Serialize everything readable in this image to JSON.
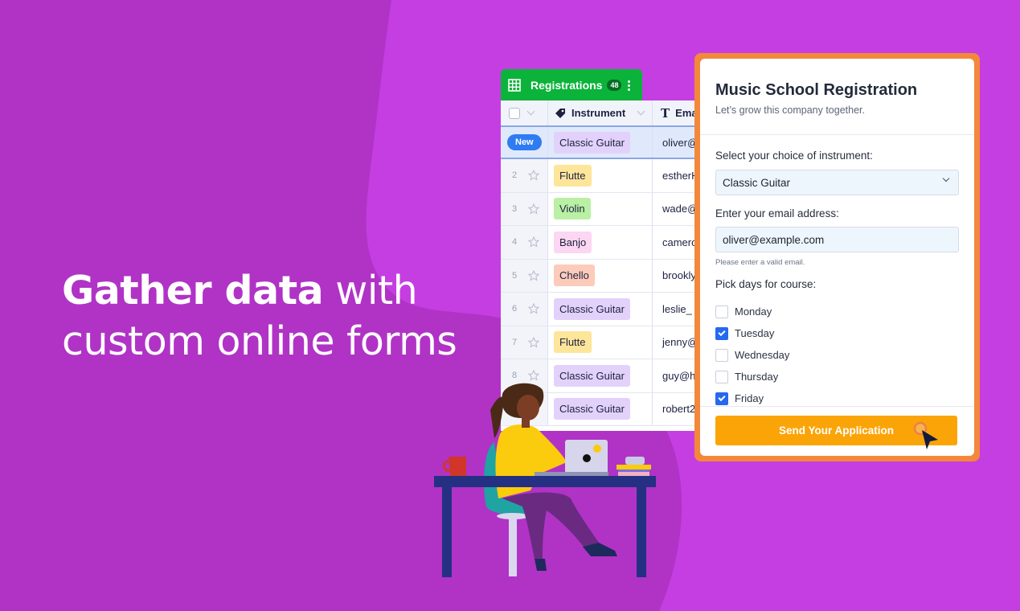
{
  "headline": {
    "bold": "Gather data",
    "rest_line1": " with",
    "line2": "custom online forms"
  },
  "table": {
    "title": "Registrations",
    "count": "48",
    "columns": [
      {
        "label": "Instrument",
        "icon": "tag-icon"
      },
      {
        "label": "Ema",
        "icon": "text-type-icon"
      }
    ],
    "new_label": "New",
    "rows": [
      {
        "num": "New",
        "instrument": "Classic Guitar",
        "email": "oliver@",
        "chip_color": "#e2d2fb"
      },
      {
        "num": "2",
        "instrument": "Flutte",
        "email": "estherH",
        "chip_color": "#fde59a"
      },
      {
        "num": "3",
        "instrument": "Violin",
        "email": "wade@",
        "chip_color": "#b9f0a4"
      },
      {
        "num": "4",
        "instrument": "Banjo",
        "email": "camero",
        "chip_color": "#fcd6f2"
      },
      {
        "num": "5",
        "instrument": "Chello",
        "email": "brookly",
        "chip_color": "#fdcbb9"
      },
      {
        "num": "6",
        "instrument": "Classic Guitar",
        "email": "leslie_",
        "chip_color": "#e2d2fb"
      },
      {
        "num": "7",
        "instrument": "Flutte",
        "email": "jenny@",
        "chip_color": "#fde59a"
      },
      {
        "num": "8",
        "instrument": "Classic Guitar",
        "email": "guy@h",
        "chip_color": "#e2d2fb"
      },
      {
        "num": "",
        "instrument": "Classic Guitar",
        "email": "robert2",
        "chip_color": "#e2d2fb"
      }
    ]
  },
  "form": {
    "title": "Music School Registration",
    "subtitle": "Let’s grow this company together.",
    "instrument_label": "Select your choice of instrument:",
    "instrument_value": "Classic Guitar",
    "email_label": "Enter your email address:",
    "email_value": "oliver@example.com",
    "email_hint": "Please enter a valid email.",
    "days_label": "Pick days for course:",
    "days": [
      {
        "label": "Monday",
        "checked": false
      },
      {
        "label": "Tuesday",
        "checked": true
      },
      {
        "label": "Wednesday",
        "checked": false
      },
      {
        "label": "Thursday",
        "checked": false
      },
      {
        "label": "Friday",
        "checked": true
      }
    ],
    "submit_label": "Send Your Application"
  },
  "colors": {
    "background": "#c53ee2",
    "background_dark": "#b033c6",
    "table_tab": "#0bb33a",
    "form_border": "#f3883a",
    "submit": "#fba408",
    "checkbox_checked": "#2469f0"
  }
}
